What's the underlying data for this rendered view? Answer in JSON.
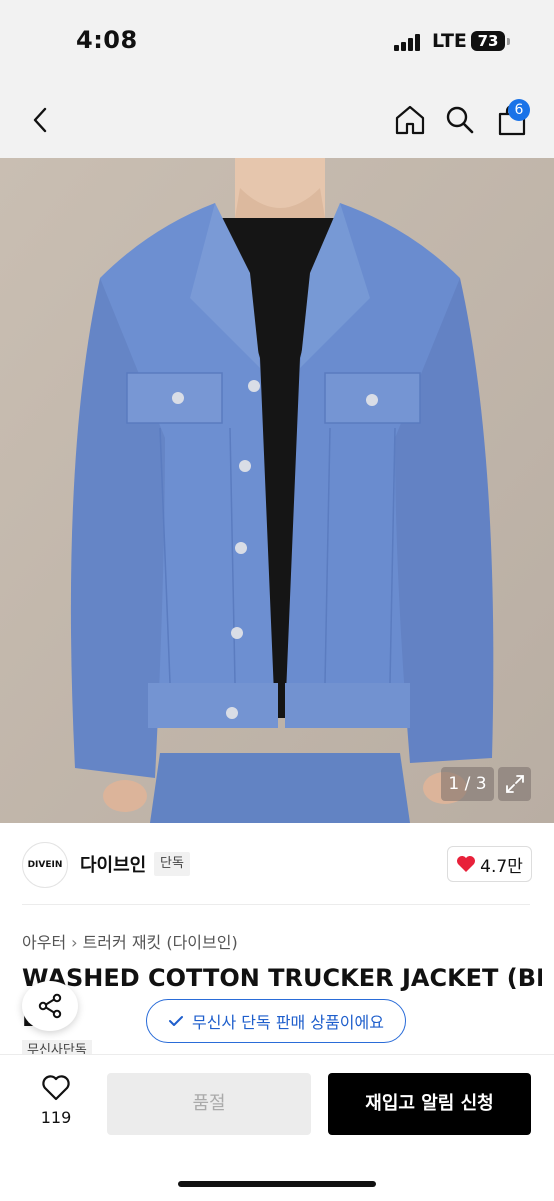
{
  "status_bar": {
    "time": "4:08",
    "network": "LTE",
    "battery": "73"
  },
  "header": {
    "cart_count": "6"
  },
  "gallery": {
    "counter": "1 / 3"
  },
  "brand": {
    "logo_text": "DIVEIN",
    "name": "다이브인",
    "tag": "단독",
    "likes": "4.7만"
  },
  "breadcrumb": {
    "category": "아우터",
    "subcategory": "트러커 재킷 (다이브인)"
  },
  "product": {
    "title_line1": "WASHED COTTON TRUCKER JACKET (BLU",
    "title_line2": "E)",
    "exclusive_tag": "무신사단독"
  },
  "notice": {
    "exclusive_text": "무신사 단독 판매 상품이에요"
  },
  "bottom_bar": {
    "wish_count": "119",
    "soldout_label": "품절",
    "restock_label": "재입고 알림 신청"
  },
  "colors": {
    "accent_blue": "#1f5fcc",
    "badge_blue": "#1a73e8",
    "heart_red": "#e8213a",
    "jacket_blue": "#6b8fd0"
  }
}
